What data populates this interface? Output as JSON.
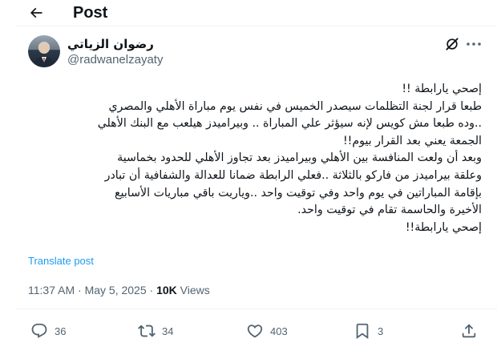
{
  "header": {
    "back_icon": "arrow-left-icon",
    "title": "Post"
  },
  "author": {
    "display_name": "رضوان الزياتي",
    "handle": "@radwanelzayaty",
    "avatar": "avatar"
  },
  "icons": {
    "grok": "grok-icon",
    "more": "more-icon"
  },
  "tweet": {
    "lines": [
      "إصحي يارابطة !!",
      "طبعا قرار لجنة التظلمات سيصدر الخميس في نفس يوم مباراة الأهلي والمصري",
      "..وده طبعا مش كويس لإنه سيؤثر علي المباراة .. وبيراميدز هيلعب مع البنك الأهلي",
      "الجمعة يعني بعد القرار بيوم!!",
      "وبعد أن ولعت المنافسة بين الأهلي وبيراميدز بعد تجاوز الأهلي  للحدود  بخماسية",
      "وعلقة بيراميدز من فاركو بالثلاثة ..فعلي الرابطة ضمانا للعدالة والشفافية  أن تبادر",
      "بإقامة المباراتين في يوم واحد وفي توقيت واحد ..وياريت باقي مباريات الأسابيع",
      "الأخيرة والحاسمة تقام في توقيت واحد.",
      "إصحي يارابطة!!"
    ]
  },
  "translate_label": "Translate post",
  "meta": {
    "time": "11:37 AM",
    "separator": " · ",
    "date": "May 5, 2025",
    "views_count": "10K",
    "views_label": " Views"
  },
  "actions": {
    "replies": "36",
    "reposts": "34",
    "likes": "403",
    "bookmarks": "3"
  }
}
